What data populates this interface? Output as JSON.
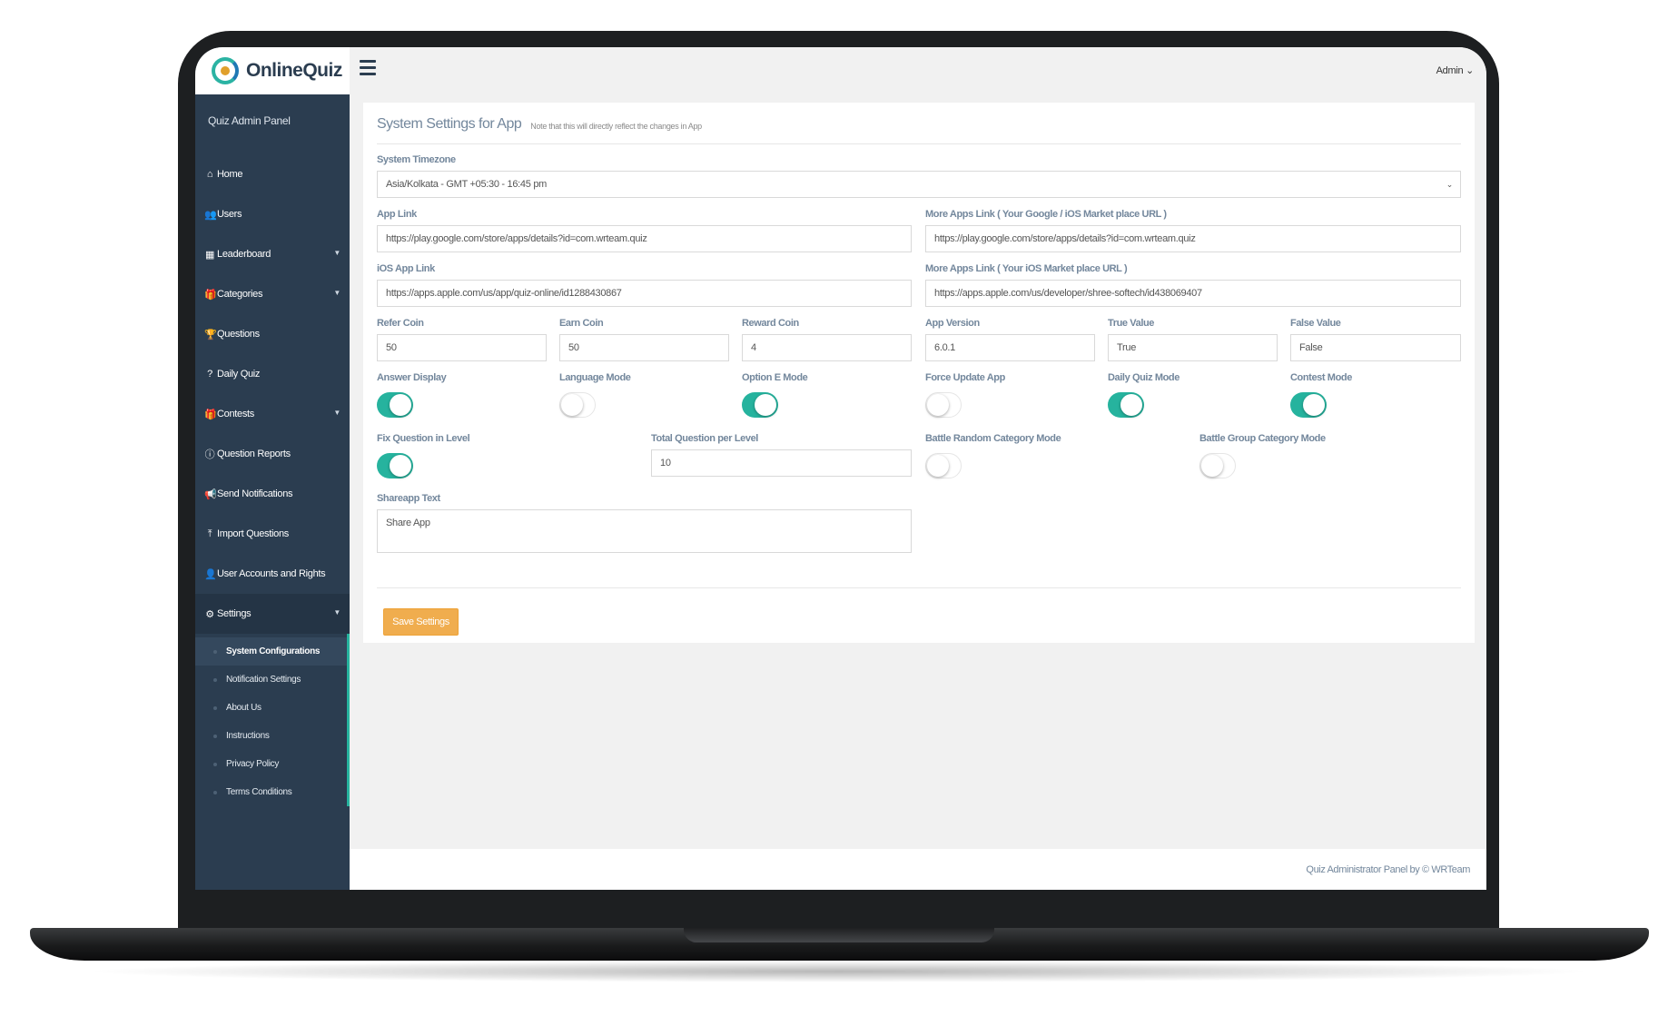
{
  "brand": {
    "name": "OnlineQuiz",
    "logo_icon": "onlinequiz-logo-icon"
  },
  "sidebar": {
    "panel_label": "Quiz Admin Panel",
    "items": [
      {
        "icon": "⌂",
        "icon_name": "home-icon",
        "label": "Home",
        "has_caret": false
      },
      {
        "icon": "👥",
        "icon_name": "users-icon",
        "label": "Users",
        "has_caret": false
      },
      {
        "icon": "▦",
        "icon_name": "table-icon",
        "label": "Leaderboard",
        "has_caret": true
      },
      {
        "icon": "🎁",
        "icon_name": "gift-icon",
        "label": "Categories",
        "has_caret": true
      },
      {
        "icon": "🏆",
        "icon_name": "trophy-icon",
        "label": "Questions",
        "has_caret": false
      },
      {
        "icon": "?",
        "icon_name": "question-icon",
        "label": "Daily Quiz",
        "has_caret": false
      },
      {
        "icon": "🎁",
        "icon_name": "gift-icon",
        "label": "Contests",
        "has_caret": true
      },
      {
        "icon": "ⓘ",
        "icon_name": "question-circle-icon",
        "label": "Question Reports",
        "has_caret": false
      },
      {
        "icon": "📢",
        "icon_name": "bullhorn-icon",
        "label": "Send Notifications",
        "has_caret": false
      },
      {
        "icon": "⤒",
        "icon_name": "upload-icon",
        "label": "Import Questions",
        "has_caret": false
      },
      {
        "icon": "👤",
        "icon_name": "user-icon",
        "label": "User Accounts and Rights",
        "has_caret": false
      },
      {
        "icon": "⚙",
        "icon_name": "gear-icon",
        "label": "Settings",
        "has_caret": true
      }
    ],
    "settings_submenu": [
      {
        "label": "System Configurations",
        "active": true
      },
      {
        "label": "Notification Settings",
        "active": false
      },
      {
        "label": "About Us",
        "active": false
      },
      {
        "label": "Instructions",
        "active": false
      },
      {
        "label": "Privacy Policy",
        "active": false
      },
      {
        "label": "Terms Conditions",
        "active": false
      }
    ]
  },
  "topbar": {
    "admin_label": "Admin"
  },
  "settings": {
    "title": "System Settings for App",
    "note": "Note that this will directly reflect the changes in App",
    "timezone": {
      "label": "System Timezone",
      "value": "Asia/Kolkata - GMT +05:30 - 16:45 pm"
    },
    "app_link": {
      "label": "App Link",
      "value": "https://play.google.com/store/apps/details?id=com.wrteam.quiz"
    },
    "more_apps_link": {
      "label": "More Apps Link ( Your Google / iOS Market place URL )",
      "value": "https://play.google.com/store/apps/details?id=com.wrteam.quiz"
    },
    "ios_app_link": {
      "label": "iOS App Link",
      "value": "https://apps.apple.com/us/app/quiz-online/id1288430867"
    },
    "more_apps_ios": {
      "label": "More Apps Link ( Your iOS Market place URL )",
      "value": "https://apps.apple.com/us/developer/shree-softech/id438069407"
    },
    "refer_coin": {
      "label": "Refer Coin",
      "value": "50"
    },
    "earn_coin": {
      "label": "Earn Coin",
      "value": "50"
    },
    "reward_coin": {
      "label": "Reward Coin",
      "value": "4"
    },
    "app_version": {
      "label": "App Version",
      "value": "6.0.1"
    },
    "true_value": {
      "label": "True Value",
      "value": "True"
    },
    "false_value": {
      "label": "False Value",
      "value": "False"
    },
    "toggles": {
      "answer_display": {
        "label": "Answer Display",
        "on": true
      },
      "language_mode": {
        "label": "Language Mode",
        "on": false
      },
      "option_e_mode": {
        "label": "Option E Mode",
        "on": true
      },
      "force_update_app": {
        "label": "Force Update App",
        "on": false
      },
      "daily_quiz_mode": {
        "label": "Daily Quiz Mode",
        "on": true
      },
      "contest_mode": {
        "label": "Contest Mode",
        "on": true
      },
      "fix_question_in_level": {
        "label": "Fix Question in Level",
        "on": true
      },
      "battle_random_category_mode": {
        "label": "Battle Random Category Mode",
        "on": false
      },
      "battle_group_category_mode": {
        "label": "Battle Group Category Mode",
        "on": false
      }
    },
    "total_question_per_level": {
      "label": "Total Question per Level",
      "value": "10"
    },
    "shareapp_text": {
      "label": "Shareapp Text",
      "value": "Share App"
    },
    "save_label": "Save Settings"
  },
  "footer": {
    "text": "Quiz Administrator Panel by © WRTeam"
  },
  "colors": {
    "sidebar": "#2b3d50",
    "accent_toggle": "#26b39e",
    "save_button": "#f0ad4e",
    "label": "#73879c"
  }
}
